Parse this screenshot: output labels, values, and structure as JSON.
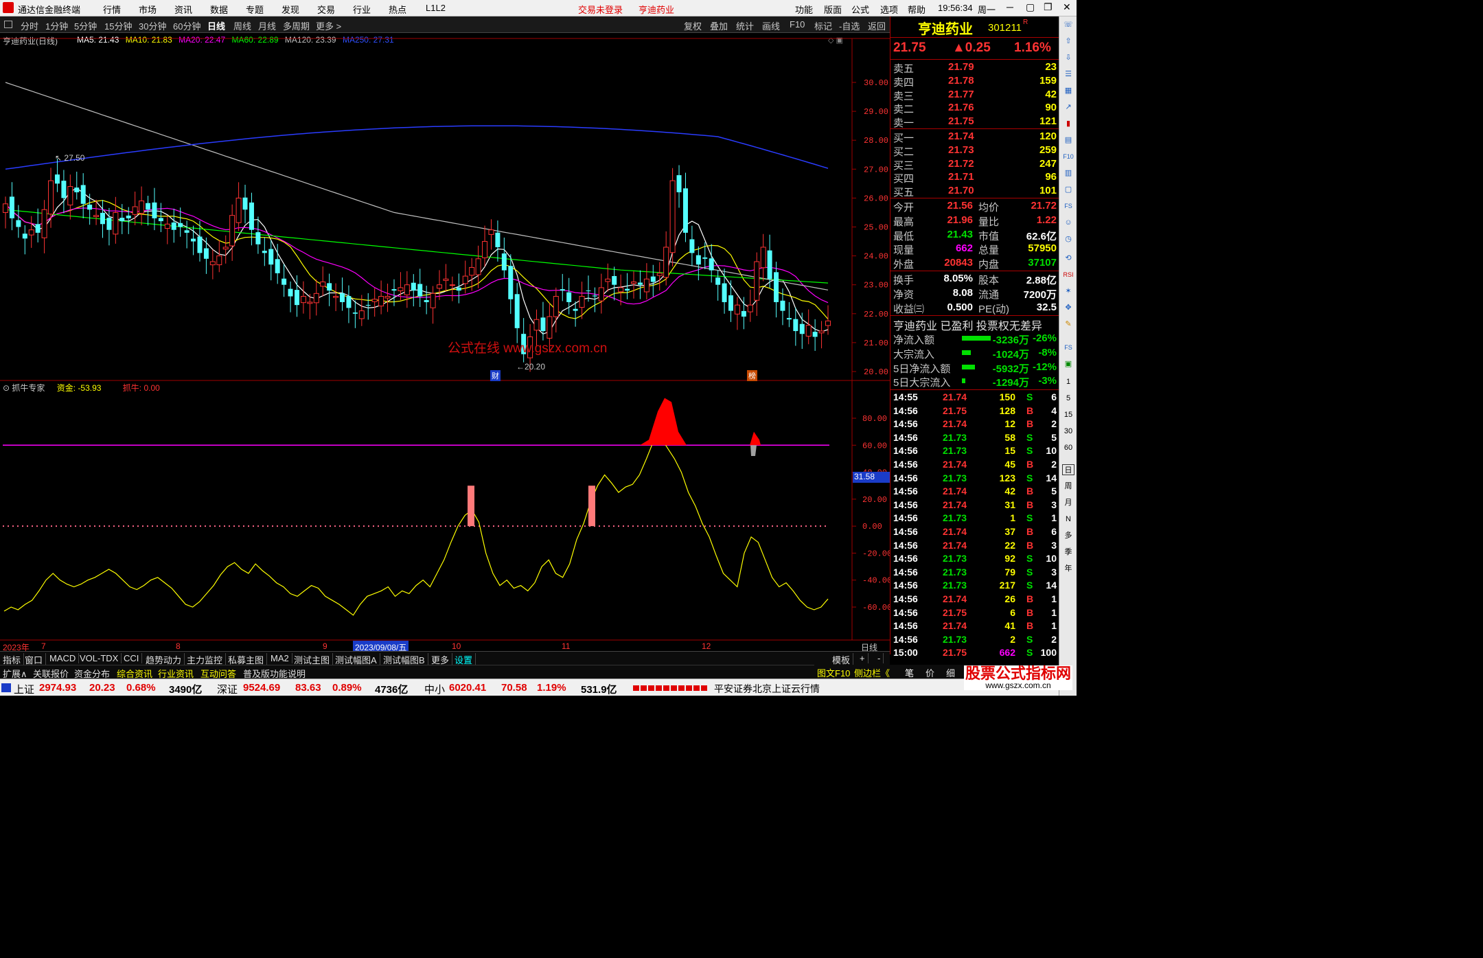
{
  "menubar": {
    "app_title": "通达信金融终端",
    "menu": [
      "行情",
      "市场",
      "资讯",
      "数据",
      "专题",
      "发现",
      "交易",
      "行业",
      "热点",
      "L1L2"
    ],
    "trade_status": "交易未登录",
    "stock_title": "亨迪药业",
    "right_menu": [
      "功能",
      "版面",
      "公式",
      "选项",
      "帮助"
    ],
    "clock": "19:56:34",
    "weekday": "周一"
  },
  "periodbar": {
    "periods": [
      "分时",
      "1分钟",
      "5分钟",
      "15分钟",
      "30分钟",
      "60分钟",
      "日线",
      "周线",
      "月线",
      "多周期",
      "更多 >"
    ],
    "selected": "日线",
    "tools": [
      "复权",
      "叠加",
      "统计",
      "画线",
      "F10",
      "标记",
      "-自选",
      "返回"
    ]
  },
  "main_chart": {
    "title": "亨迪药业(日线)",
    "ma": [
      {
        "label": "MA5: 21.43",
        "color": "#ffffff"
      },
      {
        "label": "MA10: 21.83",
        "color": "#ffff00"
      },
      {
        "label": "MA20: 22.47",
        "color": "#ff00ff"
      },
      {
        "label": "MA60: 22.89",
        "color": "#00ff00"
      },
      {
        "label": "MA120: 23.39",
        "color": "#c0c0c0"
      },
      {
        "label": "MA250: 27.31",
        "color": "#3050ff"
      }
    ],
    "price_axis": [
      "30.00",
      "29.00",
      "28.00",
      "27.00",
      "26.00",
      "25.00",
      "24.00",
      "23.00",
      "22.00",
      "21.00",
      "20.00"
    ],
    "high_label": "27.50",
    "low_label": "20.20",
    "watermark": "公式在线 www.gszx.com.cn",
    "markers": [
      "财",
      "榜"
    ]
  },
  "sub_chart": {
    "title": "抓牛专家",
    "fund_label": "资金: -53.93",
    "bull_label": "抓牛: 0.00",
    "axis": [
      "80.00",
      "60.00",
      "40.00",
      "20.00",
      "0.00",
      "-20.00",
      "-40.00",
      "-60.00"
    ],
    "current_value": "31.58"
  },
  "date_axis": {
    "labels": [
      "2023年",
      "7",
      "8",
      "9",
      "2023/09/08/五",
      "10",
      "11",
      "12"
    ],
    "period": "日线"
  },
  "tabbar": {
    "tabs": [
      "指标",
      "窗口",
      "MACD",
      "VOL-TDX",
      "CCI",
      "趋势动力",
      "主力监控",
      "私募主图",
      "MA2",
      "测试主图",
      "测试幅图A",
      "测试幅图B",
      "更多",
      "设置"
    ],
    "right_tabs": [
      "模板",
      "+",
      "-"
    ]
  },
  "infobar": {
    "items": [
      "扩展∧",
      "关联报价",
      "资金分布",
      "综合资讯",
      "行业资讯",
      "互动问答",
      "普及版功能说明"
    ],
    "right_items": [
      "图文F10",
      "侧边栏《",
      "笔",
      "价",
      "细",
      "势"
    ]
  },
  "quote": {
    "name": "亨迪药业",
    "code": "301211",
    "badge": "R",
    "price": "21.75",
    "change": "▲0.25",
    "pct": "1.16%",
    "asks": [
      {
        "label": "卖五",
        "price": "21.79",
        "vol": "23"
      },
      {
        "label": "卖四",
        "price": "21.78",
        "vol": "159"
      },
      {
        "label": "卖三",
        "price": "21.77",
        "vol": "42"
      },
      {
        "label": "卖二",
        "price": "21.76",
        "vol": "90"
      },
      {
        "label": "卖一",
        "price": "21.75",
        "vol": "121"
      }
    ],
    "bids": [
      {
        "label": "买一",
        "price": "21.74",
        "vol": "120"
      },
      {
        "label": "买二",
        "price": "21.73",
        "vol": "259"
      },
      {
        "label": "买三",
        "price": "21.72",
        "vol": "247"
      },
      {
        "label": "买四",
        "price": "21.71",
        "vol": "96"
      },
      {
        "label": "买五",
        "price": "21.70",
        "vol": "101"
      }
    ],
    "stats1": [
      {
        "l1": "今开",
        "v1": "21.56",
        "c1": "up",
        "l2": "均价",
        "v2": "21.72",
        "c2": "up"
      },
      {
        "l1": "最高",
        "v1": "21.96",
        "c1": "up",
        "l2": "量比",
        "v2": "1.22",
        "c2": "up"
      },
      {
        "l1": "最低",
        "v1": "21.43",
        "c1": "dn",
        "l2": "市值",
        "v2": "62.6亿",
        "c2": "wh"
      },
      {
        "l1": "现量",
        "v1": "662",
        "c1": "mg",
        "l2": "总量",
        "v2": "57950",
        "c2": "yl"
      },
      {
        "l1": "外盘",
        "v1": "20843",
        "c1": "up",
        "l2": "内盘",
        "v2": "37107",
        "c2": "dn"
      }
    ],
    "stats2": [
      {
        "l1": "换手",
        "v1": "8.05%",
        "c1": "wh",
        "l2": "股本",
        "v2": "2.88亿",
        "c2": "wh"
      },
      {
        "l1": "净资",
        "v1": "8.08",
        "c1": "wh",
        "l2": "流通",
        "v2": "7200万",
        "c2": "wh"
      },
      {
        "l1": "收益㈢",
        "v1": "0.500",
        "c1": "wh",
        "l2": "PE(动)",
        "v2": "32.5",
        "c2": "wh"
      }
    ],
    "tags_line": "亨迪药业 已盈利 投票权无差异",
    "flows": [
      {
        "label": "净流入额",
        "val": "-3236万",
        "pct": "-26%",
        "bar": 26
      },
      {
        "label": "大宗流入",
        "val": "-1024万",
        "pct": "-8%",
        "bar": 8
      },
      {
        "label": "5日净流入额",
        "val": "-5932万",
        "pct": "-12%",
        "bar": 12
      },
      {
        "label": "5日大宗流入",
        "val": "-1294万",
        "pct": "-3%",
        "bar": 3
      }
    ],
    "ticks": [
      {
        "t": "14:55",
        "p": "21.74",
        "v": "150",
        "s": "S",
        "n": "6"
      },
      {
        "t": "14:56",
        "p": "21.75",
        "v": "128",
        "s": "B",
        "n": "4"
      },
      {
        "t": "14:56",
        "p": "21.74",
        "v": "12",
        "s": "B",
        "n": "2"
      },
      {
        "t": "14:56",
        "p": "21.73",
        "v": "58",
        "s": "S",
        "n": "5"
      },
      {
        "t": "14:56",
        "p": "21.73",
        "v": "15",
        "s": "S",
        "n": "10"
      },
      {
        "t": "14:56",
        "p": "21.74",
        "v": "45",
        "s": "B",
        "n": "2"
      },
      {
        "t": "14:56",
        "p": "21.73",
        "v": "123",
        "s": "S",
        "n": "14"
      },
      {
        "t": "14:56",
        "p": "21.74",
        "v": "42",
        "s": "B",
        "n": "5"
      },
      {
        "t": "14:56",
        "p": "21.74",
        "v": "31",
        "s": "B",
        "n": "3"
      },
      {
        "t": "14:56",
        "p": "21.73",
        "v": "1",
        "s": "S",
        "n": "1"
      },
      {
        "t": "14:56",
        "p": "21.74",
        "v": "37",
        "s": "B",
        "n": "6"
      },
      {
        "t": "14:56",
        "p": "21.74",
        "v": "22",
        "s": "B",
        "n": "3"
      },
      {
        "t": "14:56",
        "p": "21.73",
        "v": "92",
        "s": "S",
        "n": "10"
      },
      {
        "t": "14:56",
        "p": "21.73",
        "v": "79",
        "s": "S",
        "n": "3"
      },
      {
        "t": "14:56",
        "p": "21.73",
        "v": "217",
        "s": "S",
        "n": "14"
      },
      {
        "t": "14:56",
        "p": "21.74",
        "v": "26",
        "s": "B",
        "n": "1"
      },
      {
        "t": "14:56",
        "p": "21.75",
        "v": "6",
        "s": "B",
        "n": "1"
      },
      {
        "t": "14:56",
        "p": "21.74",
        "v": "41",
        "s": "B",
        "n": "1"
      },
      {
        "t": "14:56",
        "p": "21.73",
        "v": "2",
        "s": "S",
        "n": "2"
      },
      {
        "t": "15:00",
        "p": "21.75",
        "v": "662",
        "s": "S",
        "n": "100"
      }
    ]
  },
  "sidebar_right": {
    "period_labels": [
      "1",
      "5",
      "15",
      "30",
      "60",
      "日",
      "周",
      "月",
      "N",
      "多",
      "季",
      "年"
    ]
  },
  "statusbar": {
    "indices": [
      {
        "name": "上证",
        "value": "2974.93",
        "chg": "20.23",
        "pct": "0.68%",
        "amt": "3490亿"
      },
      {
        "name": "深证",
        "value": "9524.69",
        "chg": "83.63",
        "pct": "0.89%",
        "amt": "4736亿"
      },
      {
        "name": "中小",
        "value": "6020.41",
        "chg": "70.58",
        "pct": "1.19%",
        "amt": "531.9亿"
      }
    ],
    "server": "平安证券北京上证云行情",
    "brand": "股票公式指标网",
    "brand_url": "www.gszx.com.cn"
  },
  "colors": {
    "up": "#ff3333",
    "down": "#00ffff",
    "ma5": "#ffffff",
    "ma10": "#ffff00",
    "ma20": "#ff00ff",
    "ma60": "#00ff00",
    "ma120": "#c0c0c0",
    "ma250": "#2a3cff"
  }
}
